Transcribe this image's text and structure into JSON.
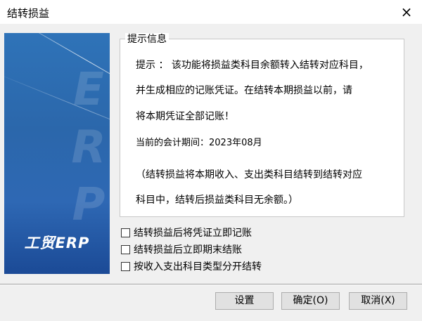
{
  "window": {
    "title": "结转损益",
    "close_icon": "×"
  },
  "banner": {
    "watermark": "ERP",
    "logo": "工贸ERP"
  },
  "info": {
    "legend": "提示信息",
    "line1": "提示 ：  该功能将损益类科目余额转入结转对应科目，",
    "line2": "并生成相应的记账凭证。在结转本期损益以前，请",
    "line3": "将本期凭证全部记账！",
    "period_label": "当前的会计期间：",
    "period_value": "2023年08月",
    "note1": "（结转损益将本期收入、支出类科目结转到结转对应",
    "note2": "科目中，结转后损益类科目无余额。）"
  },
  "options": [
    {
      "label": "结转损益后将凭证立即记账",
      "checked": false
    },
    {
      "label": "结转损益后立即期末结账",
      "checked": false
    },
    {
      "label": "按收入支出科目类型分开结转",
      "checked": false
    }
  ],
  "buttons": {
    "settings": "设置",
    "ok": "确定(O)",
    "cancel": "取消(X)"
  }
}
